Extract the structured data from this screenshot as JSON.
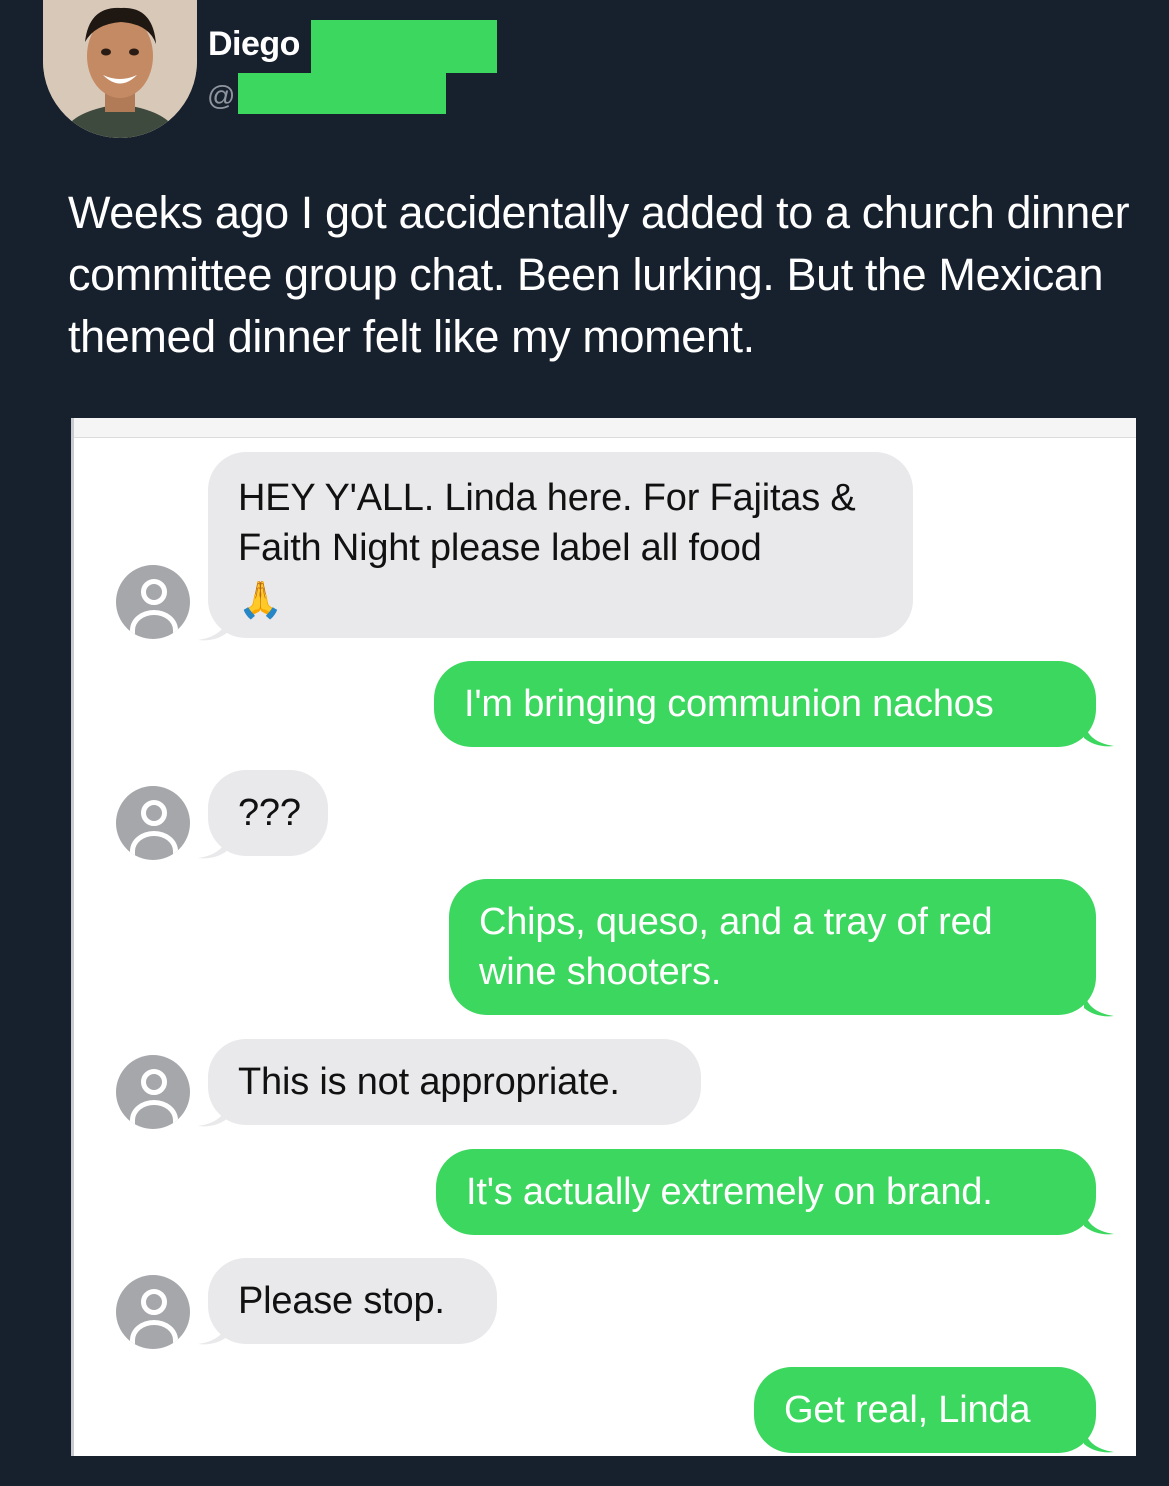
{
  "header": {
    "display_name": "Diego",
    "handle_prefix": "@"
  },
  "tweet": {
    "text": "Weeks ago I got accidentally added to a church dinner committee group chat. Been lurking. But the Mexican themed dinner felt like my moment."
  },
  "colors": {
    "background": "#17202d",
    "sent_bubble": "#3bd75e",
    "received_bubble": "#e9e9eb",
    "redaction": "#3bd75e"
  },
  "messages": [
    {
      "direction": "in",
      "text": "HEY Y'ALL. Linda here. For Fajitas & Faith Night please label all food",
      "emoji": "🙏"
    },
    {
      "direction": "out",
      "text": "I'm bringing communion nachos"
    },
    {
      "direction": "in",
      "text": "???"
    },
    {
      "direction": "out",
      "text": "Chips, queso, and a tray of red wine shooters."
    },
    {
      "direction": "in",
      "text": "This is not appropriate."
    },
    {
      "direction": "out",
      "text": "It's actually extremely on brand."
    },
    {
      "direction": "in",
      "text": "Please stop."
    },
    {
      "direction": "out",
      "text": "Get real, Linda"
    }
  ]
}
